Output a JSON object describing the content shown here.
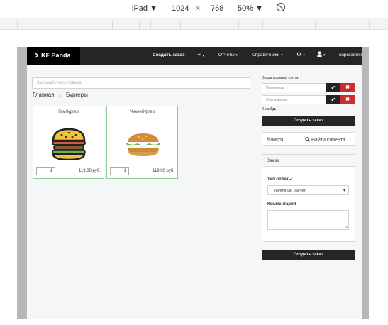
{
  "devtools": {
    "device": "iPad",
    "width": "1024",
    "times": "×",
    "height": "768",
    "zoom": "50%"
  },
  "app": {
    "brand": "KF Panda",
    "nav": {
      "create_order": "Создать заказ",
      "add": "+",
      "reports": "Отчёты",
      "directories": "Справочники",
      "settings": "⚙",
      "user": "superadmin"
    },
    "search_placeholder": "быстрый поиск товара",
    "breadcrumb": {
      "home": "Главная",
      "separator": "/",
      "current": "Бургеры"
    },
    "products": [
      {
        "name": "Гамбургер",
        "qty": "1",
        "price": "119.00 руб."
      },
      {
        "name": "Чикенбургер",
        "qty": "1",
        "price": "119.00 руб."
      }
    ],
    "cart": {
      "empty_text": "Ваша корзина пуста",
      "promo_placeholder": "Промокод",
      "cert_placeholder": "Сертификат",
      "total_prefix": "0 на",
      "total_amount": "0р.",
      "create_order": "Создать заказ"
    },
    "client": {
      "label": "Клиент",
      "find": "Найти клиента"
    },
    "order": {
      "heading": "Заказ",
      "payment_label": "Тип оплаты",
      "payment_selected": "Наличный расчет",
      "comment_label": "Комментарий",
      "create_order": "Создать заказ"
    }
  },
  "colors": {
    "nav_bg": "#252525",
    "brand_bg": "#000000",
    "accent_border": "#8ccc96",
    "danger": "#c9302c"
  }
}
